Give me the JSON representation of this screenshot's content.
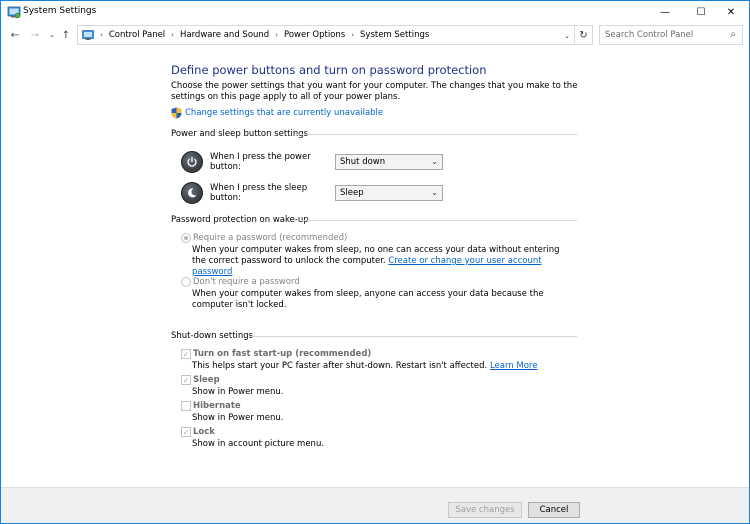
{
  "window": {
    "title": "System Settings",
    "minimize": "—",
    "maximize": "☐",
    "close": "✕"
  },
  "address": {
    "breadcrumbs": [
      "Control Panel",
      "Hardware and Sound",
      "Power Options",
      "System Settings"
    ],
    "search_placeholder": "Search Control Panel"
  },
  "main": {
    "heading": "Define power buttons and turn on password protection",
    "description": "Choose the power settings that you want for your computer. The changes that you make to the settings on this page apply to all of your power plans.",
    "change_settings_link": "Change settings that are currently unavailable"
  },
  "power_section": {
    "title": "Power and sleep button settings",
    "power_label": "When I press the power button:",
    "power_value": "Shut down",
    "sleep_label": "When I press the sleep button:",
    "sleep_value": "Sleep"
  },
  "password_section": {
    "title": "Password protection on wake-up",
    "require_label": "Require a password (recommended)",
    "require_desc": "When your computer wakes from sleep, no one can access your data without entering the correct password to unlock the computer.",
    "require_link": "Create or change your user account password",
    "no_require_label": "Don't require a password",
    "no_require_desc": "When your computer wakes from sleep, anyone can access your data because the computer isn't locked."
  },
  "shutdown_section": {
    "title": "Shut-down settings",
    "items": [
      {
        "label": "Turn on fast start-up (recommended)",
        "checked": true
      },
      {
        "label": "Sleep",
        "checked": true
      },
      {
        "label": "Hibernate",
        "checked": false
      },
      {
        "label": "Lock",
        "checked": true
      }
    ],
    "fast_desc": "This helps start your PC faster after shut-down. Restart isn't affected.",
    "fast_link": "Learn More",
    "sleep_desc": "Show in Power menu.",
    "hibernate_desc": "Show in Power menu.",
    "lock_desc": "Show in account picture menu."
  },
  "footer": {
    "save_label": "Save changes",
    "cancel_label": "Cancel"
  }
}
